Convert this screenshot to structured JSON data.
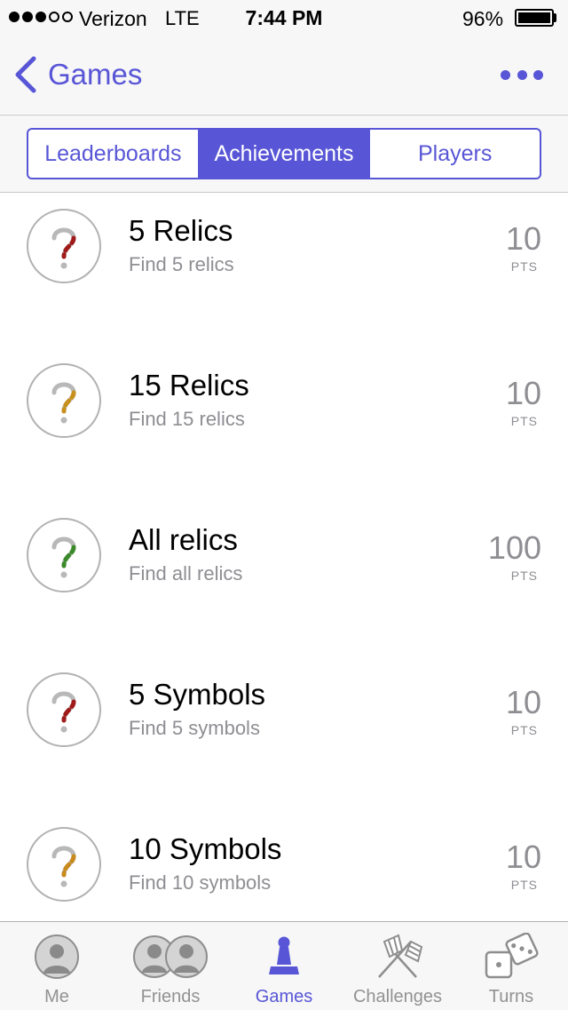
{
  "status_bar": {
    "signal_bars_filled": 3,
    "signal_bars_total": 5,
    "carrier": "Verizon",
    "network": "LTE",
    "time": "7:44 PM",
    "battery_percent": "96%",
    "battery_level": 0.96
  },
  "nav": {
    "back_label": "Games",
    "back_icon": "chevron-left-icon",
    "more_icon": "ellipsis-icon"
  },
  "segments": [
    {
      "label": "Leaderboards",
      "selected": false
    },
    {
      "label": "Achievements",
      "selected": true
    },
    {
      "label": "Players",
      "selected": false
    }
  ],
  "achievements": [
    {
      "title": "5 Relics",
      "description": "Find 5 relics",
      "points": "10",
      "points_unit": "PTS",
      "accent": "#a01a1a"
    },
    {
      "title": "15 Relics",
      "description": "Find 15 relics",
      "points": "10",
      "points_unit": "PTS",
      "accent": "#c8901c"
    },
    {
      "title": "All relics",
      "description": "Find all relics",
      "points": "100",
      "points_unit": "PTS",
      "accent": "#3a8a2a"
    },
    {
      "title": "5 Symbols",
      "description": "Find 5 symbols",
      "points": "10",
      "points_unit": "PTS",
      "accent": "#a01a1a"
    },
    {
      "title": "10 Symbols",
      "description": "Find 10 symbols",
      "points": "10",
      "points_unit": "PTS",
      "accent": "#c88a1c"
    }
  ],
  "tabs": [
    {
      "label": "Me",
      "icon": "person-icon",
      "active": false
    },
    {
      "label": "Friends",
      "icon": "people-icon",
      "active": false
    },
    {
      "label": "Games",
      "icon": "game-piece-icon",
      "active": true
    },
    {
      "label": "Challenges",
      "icon": "crossed-flags-icon",
      "active": false
    },
    {
      "label": "Turns",
      "icon": "dice-icon",
      "active": false
    }
  ],
  "colors": {
    "accent": "#5856d6",
    "secondary_text": "#8e8e93",
    "bar_background": "#f7f7f7"
  }
}
